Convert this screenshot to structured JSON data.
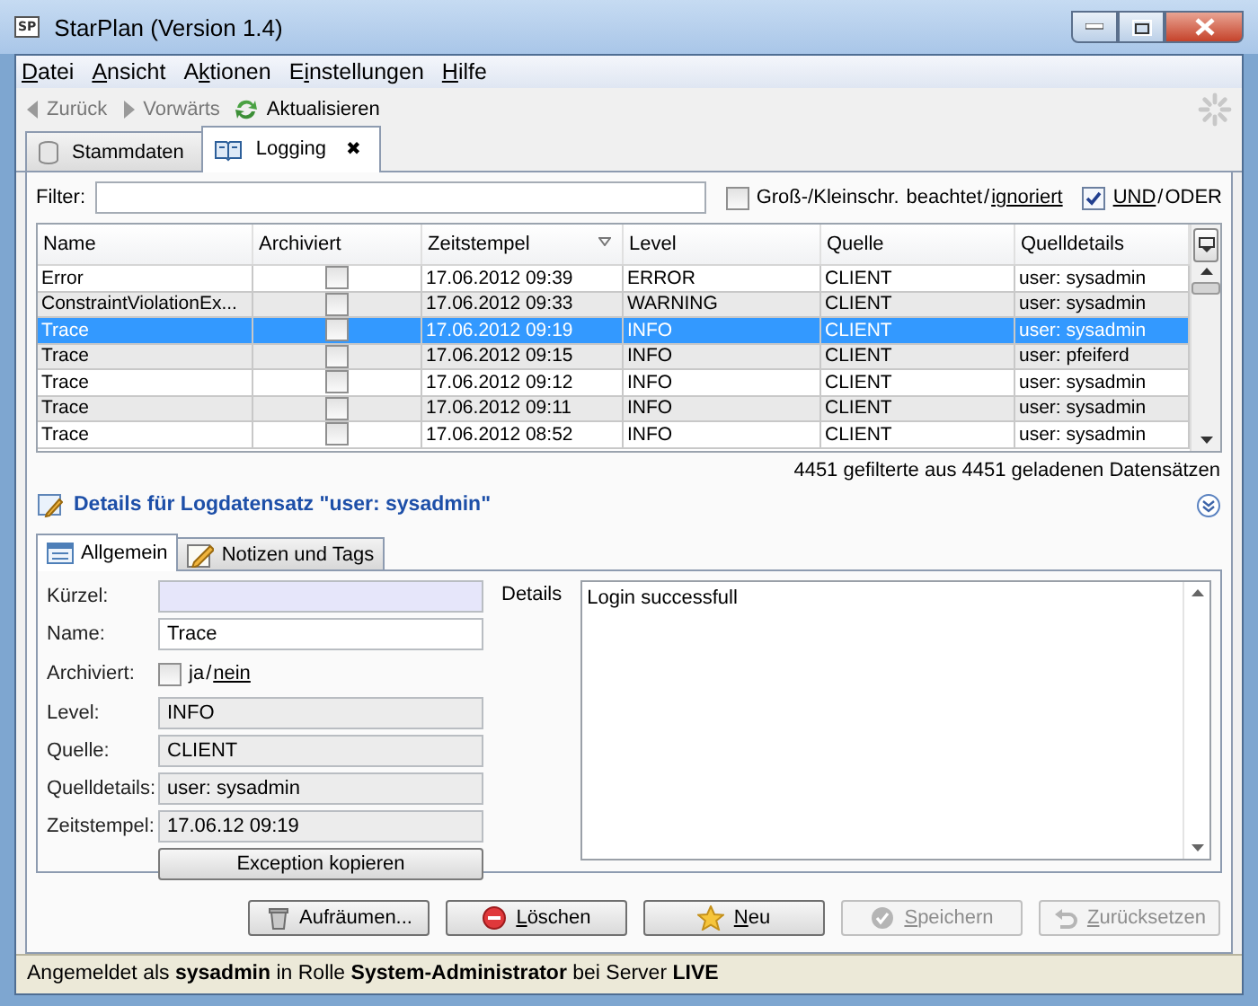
{
  "window": {
    "title": "StarPlan (Version 1.4)",
    "logo": "SP"
  },
  "menu": [
    {
      "key": "D",
      "rest": "atei"
    },
    {
      "key": "A",
      "rest": "nsicht"
    },
    {
      "lead": "A",
      "key": "k",
      "rest": "tionen"
    },
    {
      "lead": "E",
      "key": "i",
      "rest": "nstellungen"
    },
    {
      "key": "H",
      "rest": "ilfe"
    }
  ],
  "toolbar": [
    {
      "label": "Zurück",
      "kind": "back",
      "disabled": true
    },
    {
      "label": "Vorwärts",
      "kind": "forward",
      "disabled": true
    },
    {
      "label": "Aktualisieren",
      "kind": "refresh",
      "disabled": false
    }
  ],
  "tabs": [
    {
      "label": "Stammdaten",
      "kind": "database",
      "selected": false
    },
    {
      "label": "Logging",
      "kind": "book",
      "selected": true,
      "close": "✖"
    }
  ],
  "filter": {
    "label": "Filter:",
    "case_toggle": {
      "checked": false,
      "prefix": "Groß-/Kleinschr.",
      "separator": "/",
      "options": [
        {
          "label": "beachtet",
          "selected": false
        },
        {
          "label": "ignoriert",
          "selected": true
        }
      ]
    },
    "logic_toggle": {
      "checked": true,
      "separator": "/",
      "options": [
        {
          "label": "UND",
          "selected": true
        },
        {
          "label": "ODER",
          "selected": false
        }
      ]
    }
  },
  "table": {
    "columns": [
      {
        "label": "Name",
        "sorted": false
      },
      {
        "label": "Archiviert",
        "sorted": false
      },
      {
        "label": "Zeitstempel",
        "sorted": true
      },
      {
        "label": "Level",
        "sorted": false
      },
      {
        "label": "Quelle",
        "sorted": false
      },
      {
        "label": "Quelldetails",
        "sorted": false
      }
    ],
    "rows": [
      {
        "name": "Error",
        "archived": false,
        "timestamp": "17.06.2012 09:39",
        "level": "ERROR",
        "source": "CLIENT",
        "details": "user: sysadmin",
        "selected": false
      },
      {
        "name": "ConstraintViolationEx...",
        "archived": false,
        "timestamp": "17.06.2012 09:33",
        "level": "WARNING",
        "source": "CLIENT",
        "details": "user: sysadmin",
        "selected": false
      },
      {
        "name": "Trace",
        "archived": false,
        "timestamp": "17.06.2012 09:19",
        "level": "INFO",
        "source": "CLIENT",
        "details": "user: sysadmin",
        "selected": true
      },
      {
        "name": "Trace",
        "archived": false,
        "timestamp": "17.06.2012 09:15",
        "level": "INFO",
        "source": "CLIENT",
        "details": "user: pfeiferd",
        "selected": false
      },
      {
        "name": "Trace",
        "archived": false,
        "timestamp": "17.06.2012 09:12",
        "level": "INFO",
        "source": "CLIENT",
        "details": "user: sysadmin",
        "selected": false
      },
      {
        "name": "Trace",
        "archived": false,
        "timestamp": "17.06.2012 09:11",
        "level": "INFO",
        "source": "CLIENT",
        "details": "user: sysadmin",
        "selected": false
      },
      {
        "name": "Trace",
        "archived": false,
        "timestamp": "17.06.2012 08:52",
        "level": "INFO",
        "source": "CLIENT",
        "details": "user: sysadmin",
        "selected": false
      }
    ]
  },
  "record_count": "4451 gefilterte aus 4451 geladenen Datensätzen",
  "details": {
    "title": "Details für Logdatensatz \"user: sysadmin\"",
    "tabs": [
      {
        "label": "Allgemein",
        "kind": "form",
        "selected": true
      },
      {
        "label": "Notizen und Tags",
        "kind": "note",
        "selected": false
      }
    ],
    "fields": [
      {
        "kind": "text",
        "label": "Kürzel:",
        "required": true,
        "readonly": false
      },
      {
        "kind": "text",
        "label": "Name:",
        "value": "Trace",
        "required": false,
        "readonly": false
      },
      {
        "kind": "checkbox",
        "label": "Archiviert:",
        "checked": false,
        "separator": "/",
        "options": [
          {
            "label": "ja",
            "selected": false
          },
          {
            "label": "nein",
            "selected": true
          }
        ]
      },
      {
        "kind": "text",
        "label": "Level:",
        "value": "INFO",
        "required": false,
        "readonly": true
      },
      {
        "kind": "text",
        "label": "Quelle:",
        "value": "CLIENT",
        "required": false,
        "readonly": true
      },
      {
        "kind": "text",
        "label": "Quelldetails:",
        "value": "user: sysadmin",
        "required": false,
        "readonly": true
      },
      {
        "kind": "text",
        "label": "Zeitstempel:",
        "value": "17.06.12 09:19",
        "required": false,
        "readonly": true
      }
    ],
    "copy_button": "Exception kopieren",
    "text_label": "Details",
    "text": "Login successfull"
  },
  "buttons": [
    {
      "rest": "Aufräumen...",
      "kind": "cleanup",
      "disabled": false
    },
    {
      "key": "L",
      "rest": "öschen",
      "kind": "delete",
      "disabled": false
    },
    {
      "key": "N",
      "rest": "eu",
      "kind": "new",
      "disabled": false
    },
    {
      "key": "S",
      "rest": "peichern",
      "kind": "save",
      "disabled": true
    },
    {
      "key": "Z",
      "rest": "urücksetzen",
      "kind": "reset",
      "disabled": true
    }
  ],
  "status_bar": "Angemeldet als **sysadmin** in Rolle **System-Administrator** bei Server **LIVE**"
}
